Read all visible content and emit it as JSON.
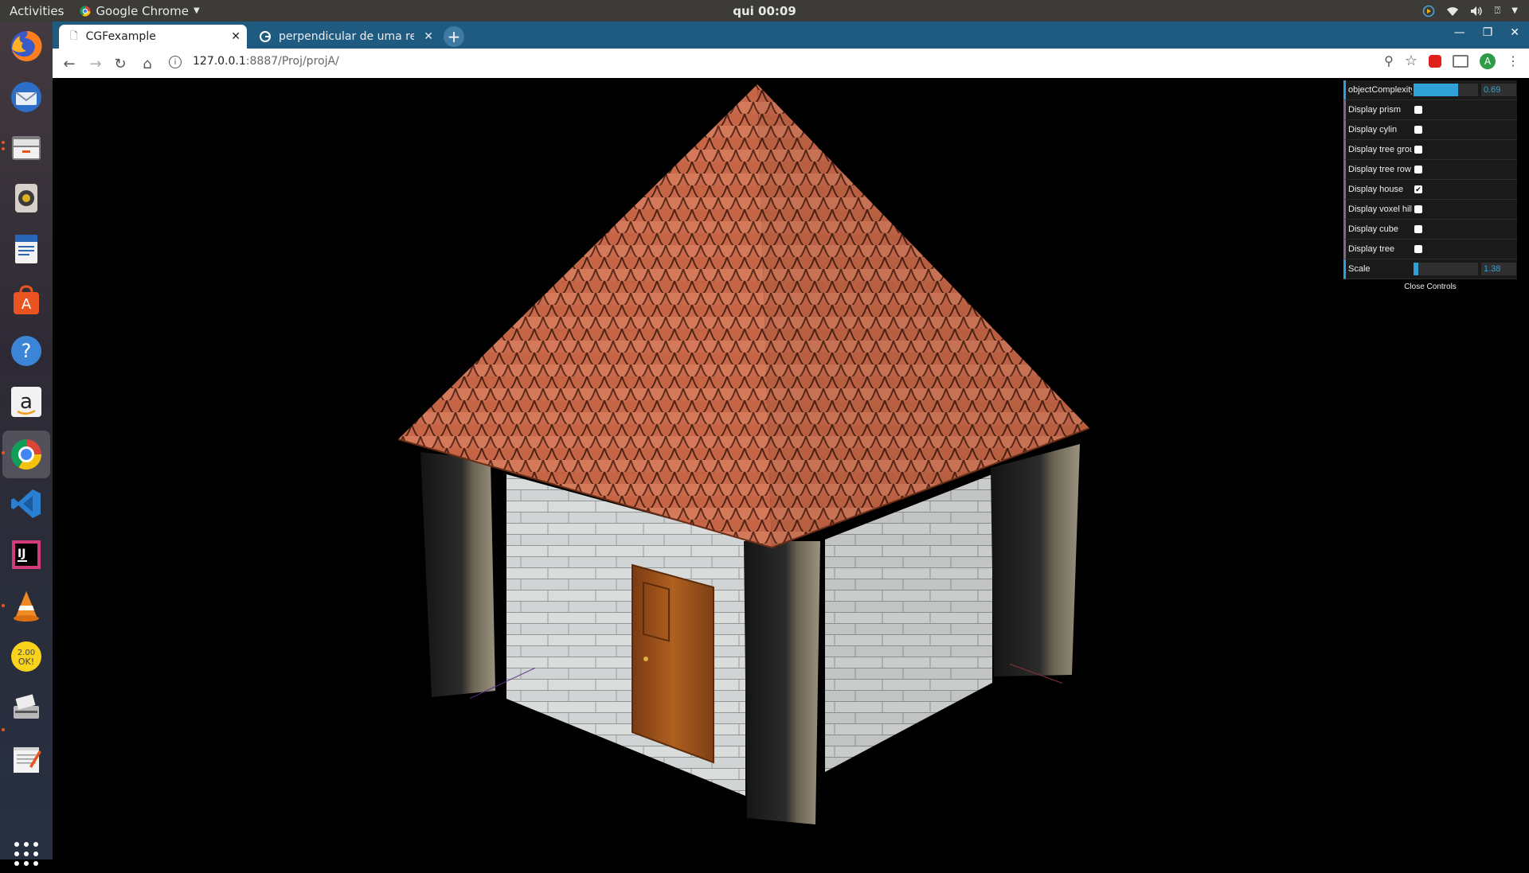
{
  "topbar": {
    "activities": "Activities",
    "app_name": "Google Chrome",
    "clock": "qui 00:09"
  },
  "dock": {
    "items": [
      "firefox-icon",
      "thunderbird-icon",
      "files-icon",
      "rhythmbox-icon",
      "writer-icon",
      "software-icon",
      "help-icon",
      "amazon-icon",
      "chrome-icon",
      "vscode-icon",
      "intellij-icon",
      "vlc-icon",
      "okular-icon",
      "scanner-icon",
      "text-editor-icon",
      "show-apps-icon"
    ]
  },
  "browser": {
    "tabs": [
      {
        "title": "CGFexample",
        "active": true
      },
      {
        "title": "perpendicular de uma ret",
        "active": false
      }
    ],
    "url_host": "127.0.0.1",
    "url_rest": ":8887/Proj/projA/",
    "profile_initial": "A"
  },
  "gui": {
    "controls": [
      {
        "label": "objectComplexity",
        "type": "number",
        "value": "0.69",
        "fraction": 0.69
      },
      {
        "label": "Display prism",
        "type": "bool",
        "checked": false
      },
      {
        "label": "Display cylin",
        "type": "bool",
        "checked": false
      },
      {
        "label": "Display tree group",
        "type": "bool",
        "checked": false
      },
      {
        "label": "Display tree row",
        "type": "bool",
        "checked": false
      },
      {
        "label": "Display house",
        "type": "bool",
        "checked": true
      },
      {
        "label": "Display voxel hill",
        "type": "bool",
        "checked": false
      },
      {
        "label": "Display cube",
        "type": "bool",
        "checked": false
      },
      {
        "label": "Display tree",
        "type": "bool",
        "checked": false
      },
      {
        "label": "Scale",
        "type": "number",
        "value": "1.38",
        "fraction": 0.08
      }
    ],
    "close_label": "Close Controls"
  },
  "colors": {
    "topbar": "#3c3b37",
    "tabstrip": "#1f5a80",
    "roof": "#c8674a",
    "wall": "#d8dcdc",
    "door": "#9a4f1d",
    "pillar": "#7a705c",
    "gui_accent": "#2fa1d6"
  }
}
